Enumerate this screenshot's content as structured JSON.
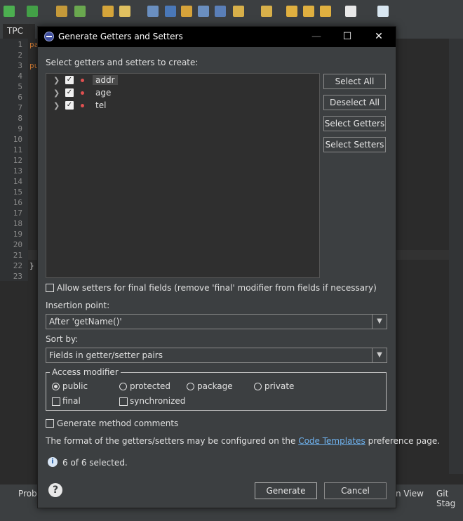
{
  "ide": {
    "editor_tab": "TPC",
    "line_numbers": [
      "1",
      "2",
      "3",
      "4",
      "5",
      "6",
      "7",
      "8",
      "9",
      "10",
      "11",
      "12",
      "13",
      "14",
      "15",
      "16",
      "17",
      "18",
      "19",
      "20",
      "21",
      "22",
      "23"
    ],
    "code_pa": "pa",
    "code_pu": "pu",
    "code_brace": "}",
    "bottom_tab_left": "Prob",
    "bottom_tab_view": "n View",
    "bottom_tab_git": "Git Stag"
  },
  "dialog": {
    "title": "Generate Getters and Setters",
    "select_label": "Select getters and setters to create:",
    "fields": [
      {
        "name": "addr",
        "checked": true
      },
      {
        "name": "age",
        "checked": true
      },
      {
        "name": "tel",
        "checked": true
      }
    ],
    "buttons": {
      "select_all": "Select All",
      "deselect_all": "Deselect All",
      "select_getters": "Select Getters",
      "select_setters": "Select Setters"
    },
    "allow_setters_label": "Allow setters for final fields (remove 'final' modifier from fields if necessary)",
    "insertion_point_label": "Insertion point:",
    "insertion_point_value": "After 'getName()'",
    "sort_by_label": "Sort by:",
    "sort_by_value": "Fields in getter/setter pairs",
    "access_modifier": {
      "title": "Access modifier",
      "options": [
        "public",
        "protected",
        "package",
        "private"
      ],
      "selected": "public",
      "final_label": "final",
      "synchronized_label": "synchronized"
    },
    "generate_comments_label": "Generate method comments",
    "format_text_before": "The format of the getters/setters may be configured on the",
    "format_link": "Code Templates",
    "format_text_after": "preference page.",
    "status": "6 of 6 selected.",
    "generate_button": "Generate",
    "cancel_button": "Cancel"
  }
}
